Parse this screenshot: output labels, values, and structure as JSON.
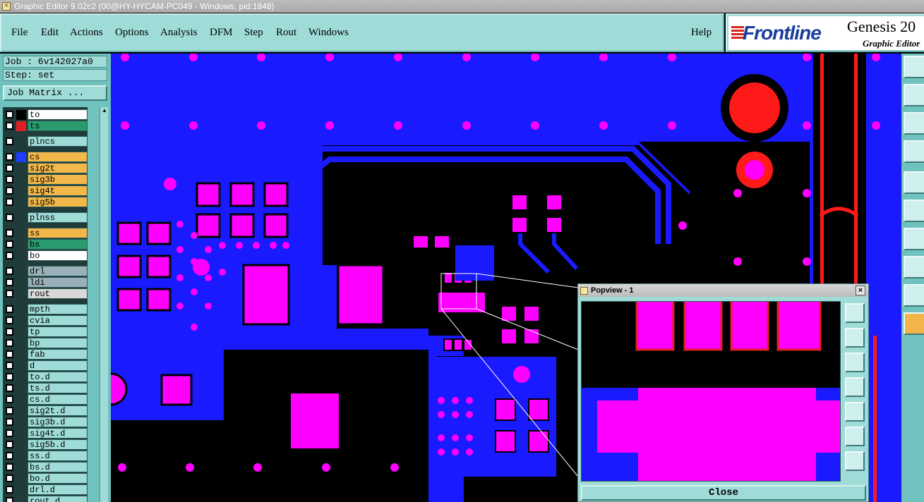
{
  "window": {
    "title": "Graphic Editor 9.02c2 (00@HY-HYCAM-PC049 - Windows, pid:1848)"
  },
  "menu": {
    "items": [
      "File",
      "Edit",
      "Actions",
      "Options",
      "Analysis",
      "DFM",
      "Step",
      "Rout",
      "Windows"
    ],
    "help": "Help"
  },
  "branding": {
    "logo": "Frontline",
    "product": "Genesis 20",
    "subtitle": "Graphic Editor"
  },
  "job": {
    "job_label": "Job : 6v142027a0",
    "step_label": "Step: set",
    "matrix_button": "Job Matrix ..."
  },
  "layers": [
    {
      "name": "to",
      "color": "#ffffff",
      "swatch": "#000000"
    },
    {
      "name": "ts",
      "color": "#2a9b6e",
      "swatch": "#e02020",
      "active": true
    },
    {
      "name": "plncs",
      "color": "#9fdcd8",
      "swatch": ""
    },
    {
      "name": "cs",
      "color": "#f4b84a",
      "swatch": "#1b3dff"
    },
    {
      "name": "sig2t",
      "color": "#f4b84a",
      "swatch": ""
    },
    {
      "name": "sig3b",
      "color": "#f4b84a",
      "swatch": ""
    },
    {
      "name": "sig4t",
      "color": "#f4b84a",
      "swatch": ""
    },
    {
      "name": "sig5b",
      "color": "#f4b84a",
      "swatch": ""
    },
    {
      "name": "plnss",
      "color": "#9fdcd8",
      "swatch": ""
    },
    {
      "name": "ss",
      "color": "#f4b84a",
      "swatch": ""
    },
    {
      "name": "bs",
      "color": "#2a9b6e",
      "swatch": ""
    },
    {
      "name": "bo",
      "color": "#ffffff",
      "swatch": ""
    },
    {
      "name": "drl",
      "color": "#9ab0b8",
      "swatch": ""
    },
    {
      "name": "ldi",
      "color": "#9ab0b8",
      "swatch": ""
    },
    {
      "name": "rout",
      "color": "#d9d9d9",
      "swatch": ""
    },
    {
      "name": "mpth",
      "color": "#9fdcd8",
      "swatch": ""
    },
    {
      "name": "cvia",
      "color": "#9fdcd8",
      "swatch": ""
    },
    {
      "name": "tp",
      "color": "#9fdcd8",
      "swatch": ""
    },
    {
      "name": "bp",
      "color": "#9fdcd8",
      "swatch": ""
    },
    {
      "name": "fab",
      "color": "#9fdcd8",
      "swatch": ""
    },
    {
      "name": "d",
      "color": "#9fdcd8",
      "swatch": ""
    },
    {
      "name": "to.d",
      "color": "#9fdcd8",
      "swatch": ""
    },
    {
      "name": "ts.d",
      "color": "#9fdcd8",
      "swatch": ""
    },
    {
      "name": "cs.d",
      "color": "#9fdcd8",
      "swatch": ""
    },
    {
      "name": "sig2t.d",
      "color": "#9fdcd8",
      "swatch": ""
    },
    {
      "name": "sig3b.d",
      "color": "#9fdcd8",
      "swatch": ""
    },
    {
      "name": "sig4t.d",
      "color": "#9fdcd8",
      "swatch": ""
    },
    {
      "name": "sig5b.d",
      "color": "#9fdcd8",
      "swatch": ""
    },
    {
      "name": "ss.d",
      "color": "#9fdcd8",
      "swatch": ""
    },
    {
      "name": "bs.d",
      "color": "#9fdcd8",
      "swatch": ""
    },
    {
      "name": "bo.d",
      "color": "#9fdcd8",
      "swatch": ""
    },
    {
      "name": "drl.d",
      "color": "#9fdcd8",
      "swatch": ""
    },
    {
      "name": "rout.d",
      "color": "#9fdcd8",
      "swatch": ""
    }
  ],
  "popview": {
    "title": "Popview - 1",
    "close_button": "Close",
    "close_icon": "close-icon"
  },
  "colors": {
    "copper": "#1a1aff",
    "pad": "#ff00ff",
    "silk": "#ff1a1a",
    "background": "#000000",
    "panel": "#9fdcd8"
  }
}
